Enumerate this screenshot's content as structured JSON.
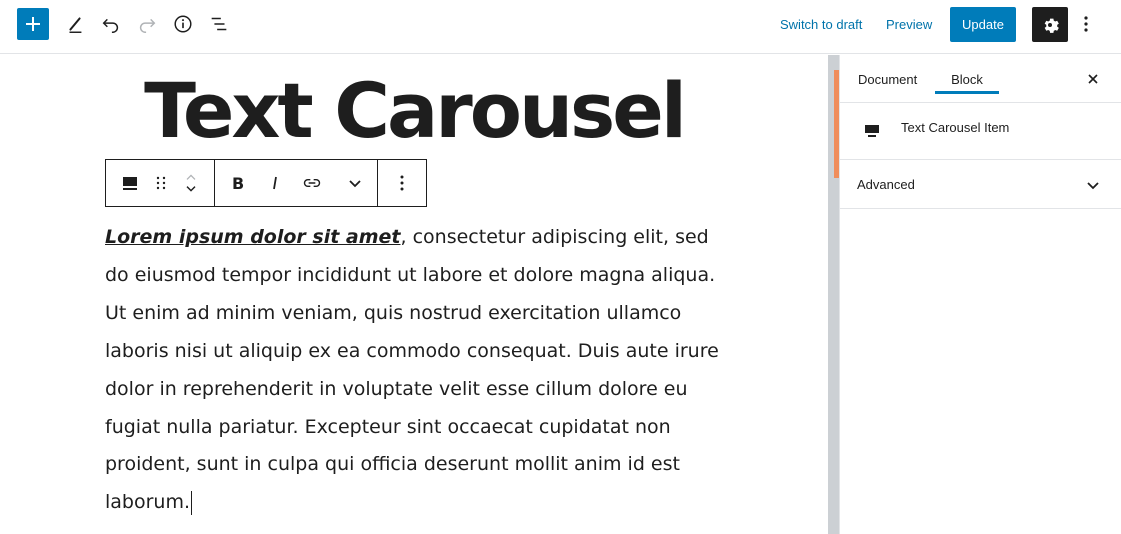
{
  "header": {
    "add_block_icon": "plus-icon",
    "tools_icon": "pencil-icon",
    "undo_icon": "undo-icon",
    "redo_icon": "redo-icon",
    "info_icon": "info-icon",
    "outline_icon": "list-view-icon",
    "switch_to_draft": "Switch to draft",
    "preview": "Preview",
    "update": "Update",
    "settings_icon": "gear-icon",
    "more_icon": "more-vertical-icon"
  },
  "editor": {
    "title": "Text Carousel",
    "paragraph_lead": "Lorem ipsum dolor sit amet",
    "paragraph_rest": ", consectetur adipiscing elit, sed do eiusmod tempor incididunt ut labore et dolore magna aliqua. Ut enim ad minim veniam, quis nostrud exercitation ullamco laboris nisi ut aliquip ex ea commodo consequat. Duis aute irure dolor in reprehenderit in voluptate velit esse cillum dolore eu fugiat nulla pariatur. Excepteur sint occaecat cupidatat non proident, sunt in culpa qui officia deserunt mollit anim id est laborum."
  },
  "block_toolbar": {
    "items": [
      "block-type-icon",
      "drag-handle-icon",
      "move-up-icon",
      "move-down-icon",
      "bold-icon",
      "italic-icon",
      "link-icon",
      "chevron-down-icon",
      "more-vertical-icon"
    ]
  },
  "sidebar": {
    "tabs": [
      {
        "label": "Document",
        "active": false
      },
      {
        "label": "Block",
        "active": true
      }
    ],
    "close_icon": "close-icon",
    "block_name": "Text Carousel Item",
    "advanced_label": "Advanced"
  },
  "colors": {
    "accent": "#007cba",
    "dark": "#1e1e1e",
    "scroll_thumb": "#f08d5b"
  }
}
